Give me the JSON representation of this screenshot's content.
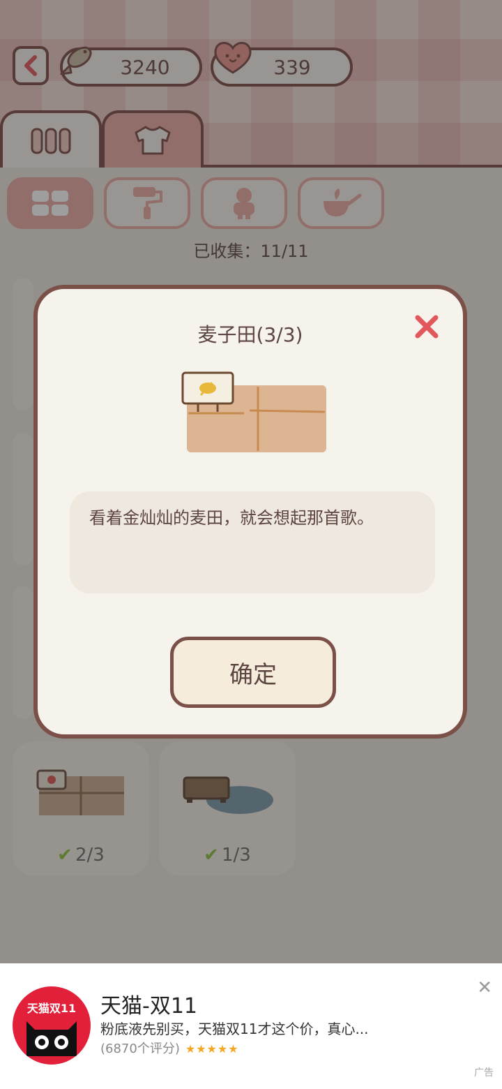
{
  "header": {
    "fish_count": "3240",
    "heart_count": "339",
    "icons": {
      "back": "chevron-left-icon",
      "fish": "fish-icon",
      "heart": "heart-icon",
      "tab_fence": "fence-icon",
      "tab_shirt": "shirt-icon"
    }
  },
  "categories": {
    "items": [
      {
        "icon": "grid-icon",
        "active": true
      },
      {
        "icon": "paint-roller-icon",
        "active": false
      },
      {
        "icon": "character-icon",
        "active": false
      },
      {
        "icon": "watering-can-icon",
        "active": false
      }
    ]
  },
  "collection": {
    "collected_text": "已收集：11/11",
    "visible_items": [
      {
        "progress": "2/3",
        "icon": "strawberry-field-icon"
      },
      {
        "progress": "1/3",
        "icon": "pond-bench-icon"
      }
    ]
  },
  "modal": {
    "title": "麦子田(3/3)",
    "description": "看着金灿灿的麦田，就会想起那首歌。",
    "confirm_label": "确定",
    "close_icon": "close-icon",
    "image_icon": "wheat-field-icon"
  },
  "ad": {
    "logo_text": "天猫双11",
    "title": "天猫-双11",
    "subtitle": "粉底液先别买，天猫双11才这个价，真心...",
    "rating": "(6870个评分)",
    "stars": "★★★★★",
    "tag": "广告",
    "close": "✕"
  },
  "colors": {
    "accent_pink": "#e7a8a0",
    "border_brown": "#7b4a45",
    "close_red": "#e2575b",
    "check_green": "#8bbf3b",
    "ad_red": "#e2203a"
  }
}
